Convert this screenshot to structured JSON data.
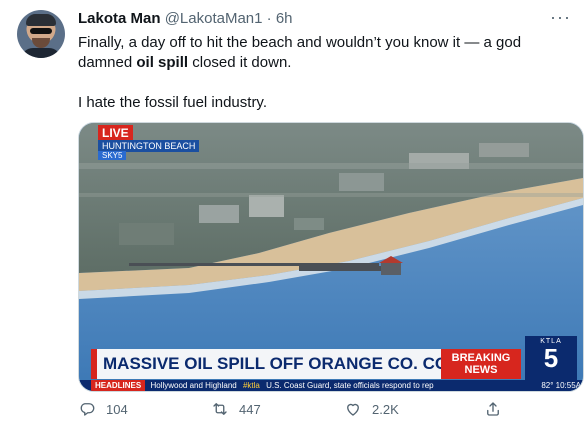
{
  "tweet": {
    "author_name": "Lakota Man",
    "handle": "@LakotaMan1",
    "separator": "·",
    "time": "6h",
    "text_line1_pre": "Finally, a day off to hit the beach and wouldn’t you know it — a god damned ",
    "text_bold": "oil spill",
    "text_line1_post": " closed it down.",
    "text_line2": "I hate the fossil fuel industry."
  },
  "media": {
    "live_label": "LIVE",
    "location_label": "HUNTINGTON BEACH",
    "location_sub": "SKY5",
    "headline": "MASSIVE OIL SPILL OFF ORANGE CO. COAST",
    "breaking_line1": "BREAKING",
    "breaking_line2": "NEWS",
    "station_small": "KTLA",
    "station_big": "5",
    "ticker_head": "HEADLINES",
    "ticker_item1": "Hollywood and Highland",
    "ticker_tag": "#ktla",
    "ticker_item2": "U.S. Coast Guard, state officials respond to rep",
    "ticker_right": "82° 10:55A"
  },
  "actions": {
    "reply_count": "104",
    "retweet_count": "447",
    "like_count": "2.2K"
  },
  "colors": {
    "accent_red": "#d7261e",
    "news_blue": "#0b2a6e",
    "secondary_text": "#536471"
  },
  "icons": [
    "more-icon",
    "reply-icon",
    "retweet-icon",
    "like-icon",
    "share-icon"
  ]
}
